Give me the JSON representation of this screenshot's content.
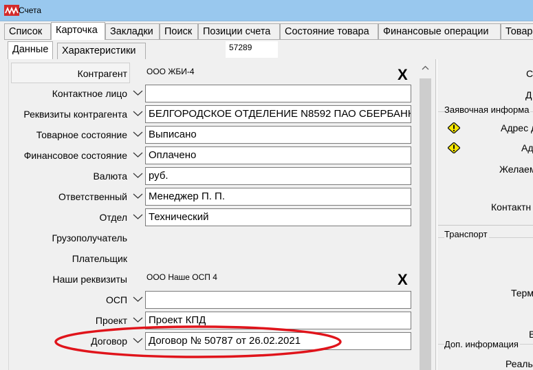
{
  "window": {
    "title": "Счета"
  },
  "tabs": [
    "Список",
    "Карточка",
    "Закладки",
    "Поиск",
    "Позиции счета",
    "Состояние товара",
    "Финансовые операции",
    "Товар"
  ],
  "subtabs": [
    "Данные",
    "Характеристики"
  ],
  "doc_number": "57289",
  "header": {
    "label": "Контрагент",
    "value": "ООО ЖБИ-4",
    "clear": "X"
  },
  "fields": {
    "contact": {
      "label": "Контактное лицо",
      "value": ""
    },
    "requisites": {
      "label": "Реквизиты контрагента",
      "value": "БЕЛГОРОДСКОЕ ОТДЕЛЕНИЕ N8592 ПАО СБЕРБАНК"
    },
    "goods_state": {
      "label": "Товарное состояние",
      "value": "Выписано"
    },
    "fin_state": {
      "label": "Финансовое состояние",
      "value": "Оплачено"
    },
    "currency": {
      "label": "Валюта",
      "value": "руб."
    },
    "responsible": {
      "label": "Ответственный",
      "value": "Менеджер П. П."
    },
    "department": {
      "label": "Отдел",
      "value": "Технический"
    },
    "consignee": {
      "label": "Грузополучатель"
    },
    "payer": {
      "label": "Плательщик"
    },
    "our_requisites": {
      "label": "Наши реквизиты",
      "value": "ООО Наше ОСП 4",
      "clear": "X"
    },
    "osp": {
      "label": "ОСП",
      "value": ""
    },
    "project": {
      "label": "Проект",
      "value": "Проект КПД"
    },
    "contract": {
      "label": "Договор",
      "value": "Договор № 50787 от 26.02.2021"
    }
  },
  "right_panel": {
    "top_c": "С",
    "top_d": "Д",
    "section_request": "Заявочная информа",
    "addr1": "Адрес д",
    "addr2": "Ад",
    "wish": "Желаем",
    "contact": "Контактн",
    "section_transport": "Транспорт",
    "term": "Терм",
    "v": "В",
    "section_extra": "Доп. информация",
    "real": "Реальн"
  },
  "colors": {
    "titlebar": "#99c8ee",
    "annotation": "#e0141b",
    "logo": "#d42a2a",
    "warning": "#f5e600"
  },
  "icons": [
    "app-logo-icon",
    "chevron-down-icon",
    "warning-icon",
    "scroll-up-arrow-icon"
  ]
}
